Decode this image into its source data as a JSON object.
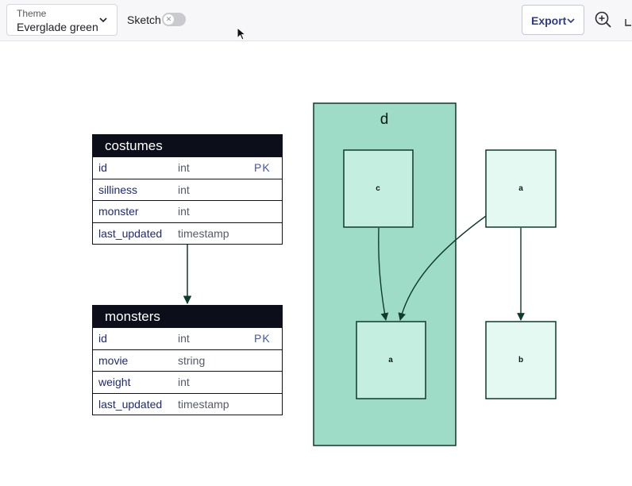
{
  "toolbar": {
    "theme_label": "Theme",
    "theme_value": "Everglade green",
    "sketch_label": "Sketch",
    "sketch_enabled": false,
    "export_label": "Export",
    "icons": [
      "chevron-down-icon",
      "close-icon",
      "zoom-in-icon",
      "cursor-icon"
    ]
  },
  "er": {
    "tables": [
      {
        "name": "costumes",
        "columns": [
          {
            "name": "id",
            "type": "int",
            "key": "PK"
          },
          {
            "name": "silliness",
            "type": "int",
            "key": ""
          },
          {
            "name": "monster",
            "type": "int",
            "key": ""
          },
          {
            "name": "last_updated",
            "type": "timestamp",
            "key": ""
          }
        ]
      },
      {
        "name": "monsters",
        "columns": [
          {
            "name": "id",
            "type": "int",
            "key": "PK"
          },
          {
            "name": "movie",
            "type": "string",
            "key": ""
          },
          {
            "name": "weight",
            "type": "int",
            "key": ""
          },
          {
            "name": "last_updated",
            "type": "timestamp",
            "key": ""
          }
        ]
      }
    ]
  },
  "graph": {
    "container_label": "d",
    "nodes": {
      "c": "c",
      "a_inner": "a",
      "a_outer": "a",
      "b": "b"
    },
    "colors": {
      "container_fill": "#9fdcc7",
      "inner_node_fill": "#c4eedf",
      "outer_node_fill": "#e3f9f1",
      "stroke": "#0e3b2b"
    }
  }
}
